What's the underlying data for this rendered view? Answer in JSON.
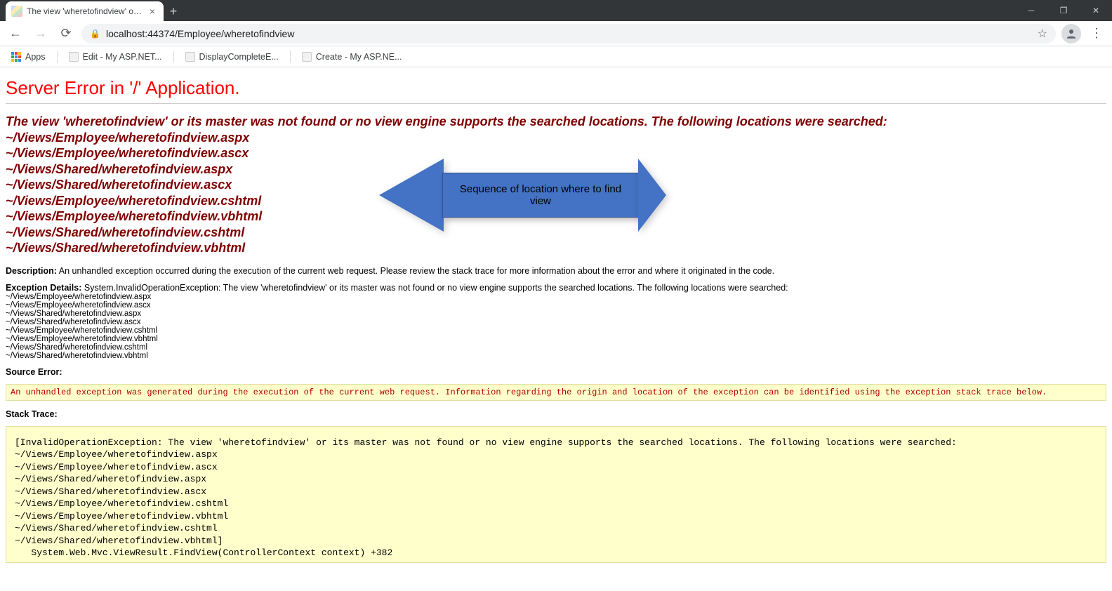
{
  "browser": {
    "tab_title": "The view 'wheretofindview' or its",
    "url": "localhost:44374/Employee/wheretofindview",
    "apps_label": "Apps",
    "bookmarks": [
      "Edit - My ASP.NET...",
      "DisplayCompleteE...",
      "Create - My ASP.NE..."
    ]
  },
  "error": {
    "title": "Server Error in '/' Application.",
    "message_heading": "The view 'wheretofindview' or its master was not found or no view engine supports the searched locations. The following locations were searched:",
    "locations": [
      "~/Views/Employee/wheretofindview.aspx",
      "~/Views/Employee/wheretofindview.ascx",
      "~/Views/Shared/wheretofindview.aspx",
      "~/Views/Shared/wheretofindview.ascx",
      "~/Views/Employee/wheretofindview.cshtml",
      "~/Views/Employee/wheretofindview.vbhtml",
      "~/Views/Shared/wheretofindview.cshtml",
      "~/Views/Shared/wheretofindview.vbhtml"
    ],
    "description_label": "Description:",
    "description_text": "An unhandled exception occurred during the execution of the current web request. Please review the stack trace for more information about the error and where it originated in the code.",
    "exception_label": "Exception Details:",
    "exception_text": "System.InvalidOperationException: The view 'wheretofindview' or its master was not found or no view engine supports the searched locations. The following locations were searched:",
    "source_error_label": "Source Error:",
    "source_error_text": "An unhandled exception was generated during the execution of the current web request. Information regarding the origin and location of the exception can be identified using the exception stack trace below.",
    "stack_trace_label": "Stack Trace:",
    "stack_trace_text": "[InvalidOperationException: The view 'wheretofindview' or its master was not found or no view engine supports the searched locations. The following locations were searched:\n~/Views/Employee/wheretofindview.aspx\n~/Views/Employee/wheretofindview.ascx\n~/Views/Shared/wheretofindview.aspx\n~/Views/Shared/wheretofindview.ascx\n~/Views/Employee/wheretofindview.cshtml\n~/Views/Employee/wheretofindview.vbhtml\n~/Views/Shared/wheretofindview.cshtml\n~/Views/Shared/wheretofindview.vbhtml]\n   System.Web.Mvc.ViewResult.FindView(ControllerContext context) +382"
  },
  "callout": {
    "text": "Sequence of location where to find view"
  }
}
